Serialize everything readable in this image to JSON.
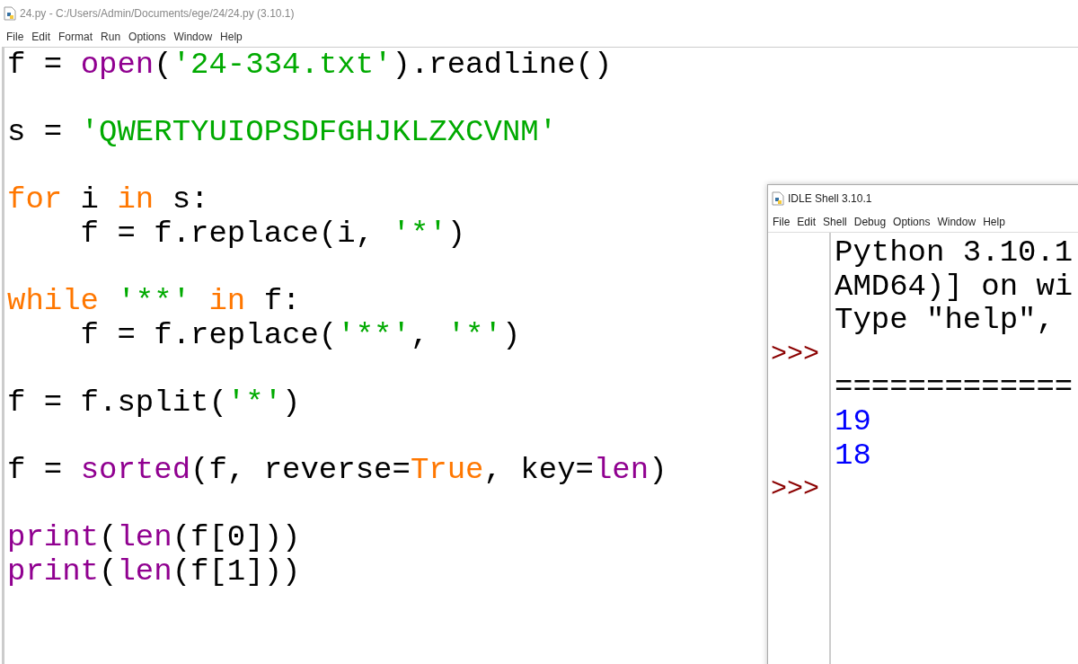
{
  "editor": {
    "title": "24.py - C:/Users/Admin/Documents/ege/24/24.py (3.10.1)",
    "menu": [
      "File",
      "Edit",
      "Format",
      "Run",
      "Options",
      "Window",
      "Help"
    ],
    "lines": [
      {
        "kind": "code",
        "tokens": [
          {
            "kind": "name",
            "text": "f = "
          },
          {
            "kind": "builtin",
            "text": "open"
          },
          {
            "kind": "name",
            "text": "("
          },
          {
            "kind": "string",
            "text": "'24-334.txt'"
          },
          {
            "kind": "name",
            "text": ").readline()"
          }
        ]
      },
      {
        "kind": "blank"
      },
      {
        "kind": "code",
        "tokens": [
          {
            "kind": "name",
            "text": "s = "
          },
          {
            "kind": "string",
            "text": "'QWERTYUIOPSDFGHJKLZXCVNM'"
          }
        ]
      },
      {
        "kind": "blank"
      },
      {
        "kind": "code",
        "tokens": [
          {
            "kind": "keyword",
            "text": "for"
          },
          {
            "kind": "name",
            "text": " i "
          },
          {
            "kind": "keyword",
            "text": "in"
          },
          {
            "kind": "name",
            "text": " s:"
          }
        ]
      },
      {
        "kind": "code",
        "tokens": [
          {
            "kind": "name",
            "text": "    f = f.replace(i, "
          },
          {
            "kind": "string",
            "text": "'*'"
          },
          {
            "kind": "name",
            "text": ")"
          }
        ]
      },
      {
        "kind": "blank"
      },
      {
        "kind": "code",
        "tokens": [
          {
            "kind": "keyword",
            "text": "while"
          },
          {
            "kind": "string",
            "text": " '**'"
          },
          {
            "kind": "keyword",
            "text": " in"
          },
          {
            "kind": "name",
            "text": " f:"
          }
        ]
      },
      {
        "kind": "code",
        "tokens": [
          {
            "kind": "name",
            "text": "    f = f.replace("
          },
          {
            "kind": "string",
            "text": "'**'"
          },
          {
            "kind": "name",
            "text": ", "
          },
          {
            "kind": "string",
            "text": "'*'"
          },
          {
            "kind": "name",
            "text": ")"
          }
        ]
      },
      {
        "kind": "blank"
      },
      {
        "kind": "code",
        "tokens": [
          {
            "kind": "name",
            "text": "f = f.split("
          },
          {
            "kind": "string",
            "text": "'*'"
          },
          {
            "kind": "name",
            "text": ")"
          }
        ]
      },
      {
        "kind": "blank"
      },
      {
        "kind": "code",
        "tokens": [
          {
            "kind": "name",
            "text": "f = "
          },
          {
            "kind": "builtin",
            "text": "sorted"
          },
          {
            "kind": "name",
            "text": "(f, reverse="
          },
          {
            "kind": "keyword",
            "text": "True"
          },
          {
            "kind": "name",
            "text": ", key="
          },
          {
            "kind": "builtin",
            "text": "len"
          },
          {
            "kind": "name",
            "text": ")"
          }
        ]
      },
      {
        "kind": "blank"
      },
      {
        "kind": "code",
        "tokens": [
          {
            "kind": "builtin",
            "text": "print"
          },
          {
            "kind": "name",
            "text": "("
          },
          {
            "kind": "builtin",
            "text": "len"
          },
          {
            "kind": "name",
            "text": "(f[0]))"
          }
        ]
      },
      {
        "kind": "code",
        "tokens": [
          {
            "kind": "builtin",
            "text": "print"
          },
          {
            "kind": "name",
            "text": "("
          },
          {
            "kind": "builtin",
            "text": "len"
          },
          {
            "kind": "name",
            "text": "(f[1]))"
          }
        ]
      }
    ]
  },
  "shell": {
    "title": "IDLE Shell 3.10.1",
    "menu": [
      "File",
      "Edit",
      "Shell",
      "Debug",
      "Options",
      "Window",
      "Help"
    ],
    "rows": [
      {
        "kind": "info",
        "text": "Python 3.10.1"
      },
      {
        "kind": "info",
        "text": "AMD64)] on wi"
      },
      {
        "kind": "info",
        "text": "Type \"help\","
      },
      {
        "prompt": ">>>"
      },
      {
        "kind": "info",
        "text": "============="
      },
      {
        "kind": "output",
        "text": "19"
      },
      {
        "kind": "output",
        "text": "18"
      },
      {
        "prompt": ">>>"
      }
    ]
  }
}
